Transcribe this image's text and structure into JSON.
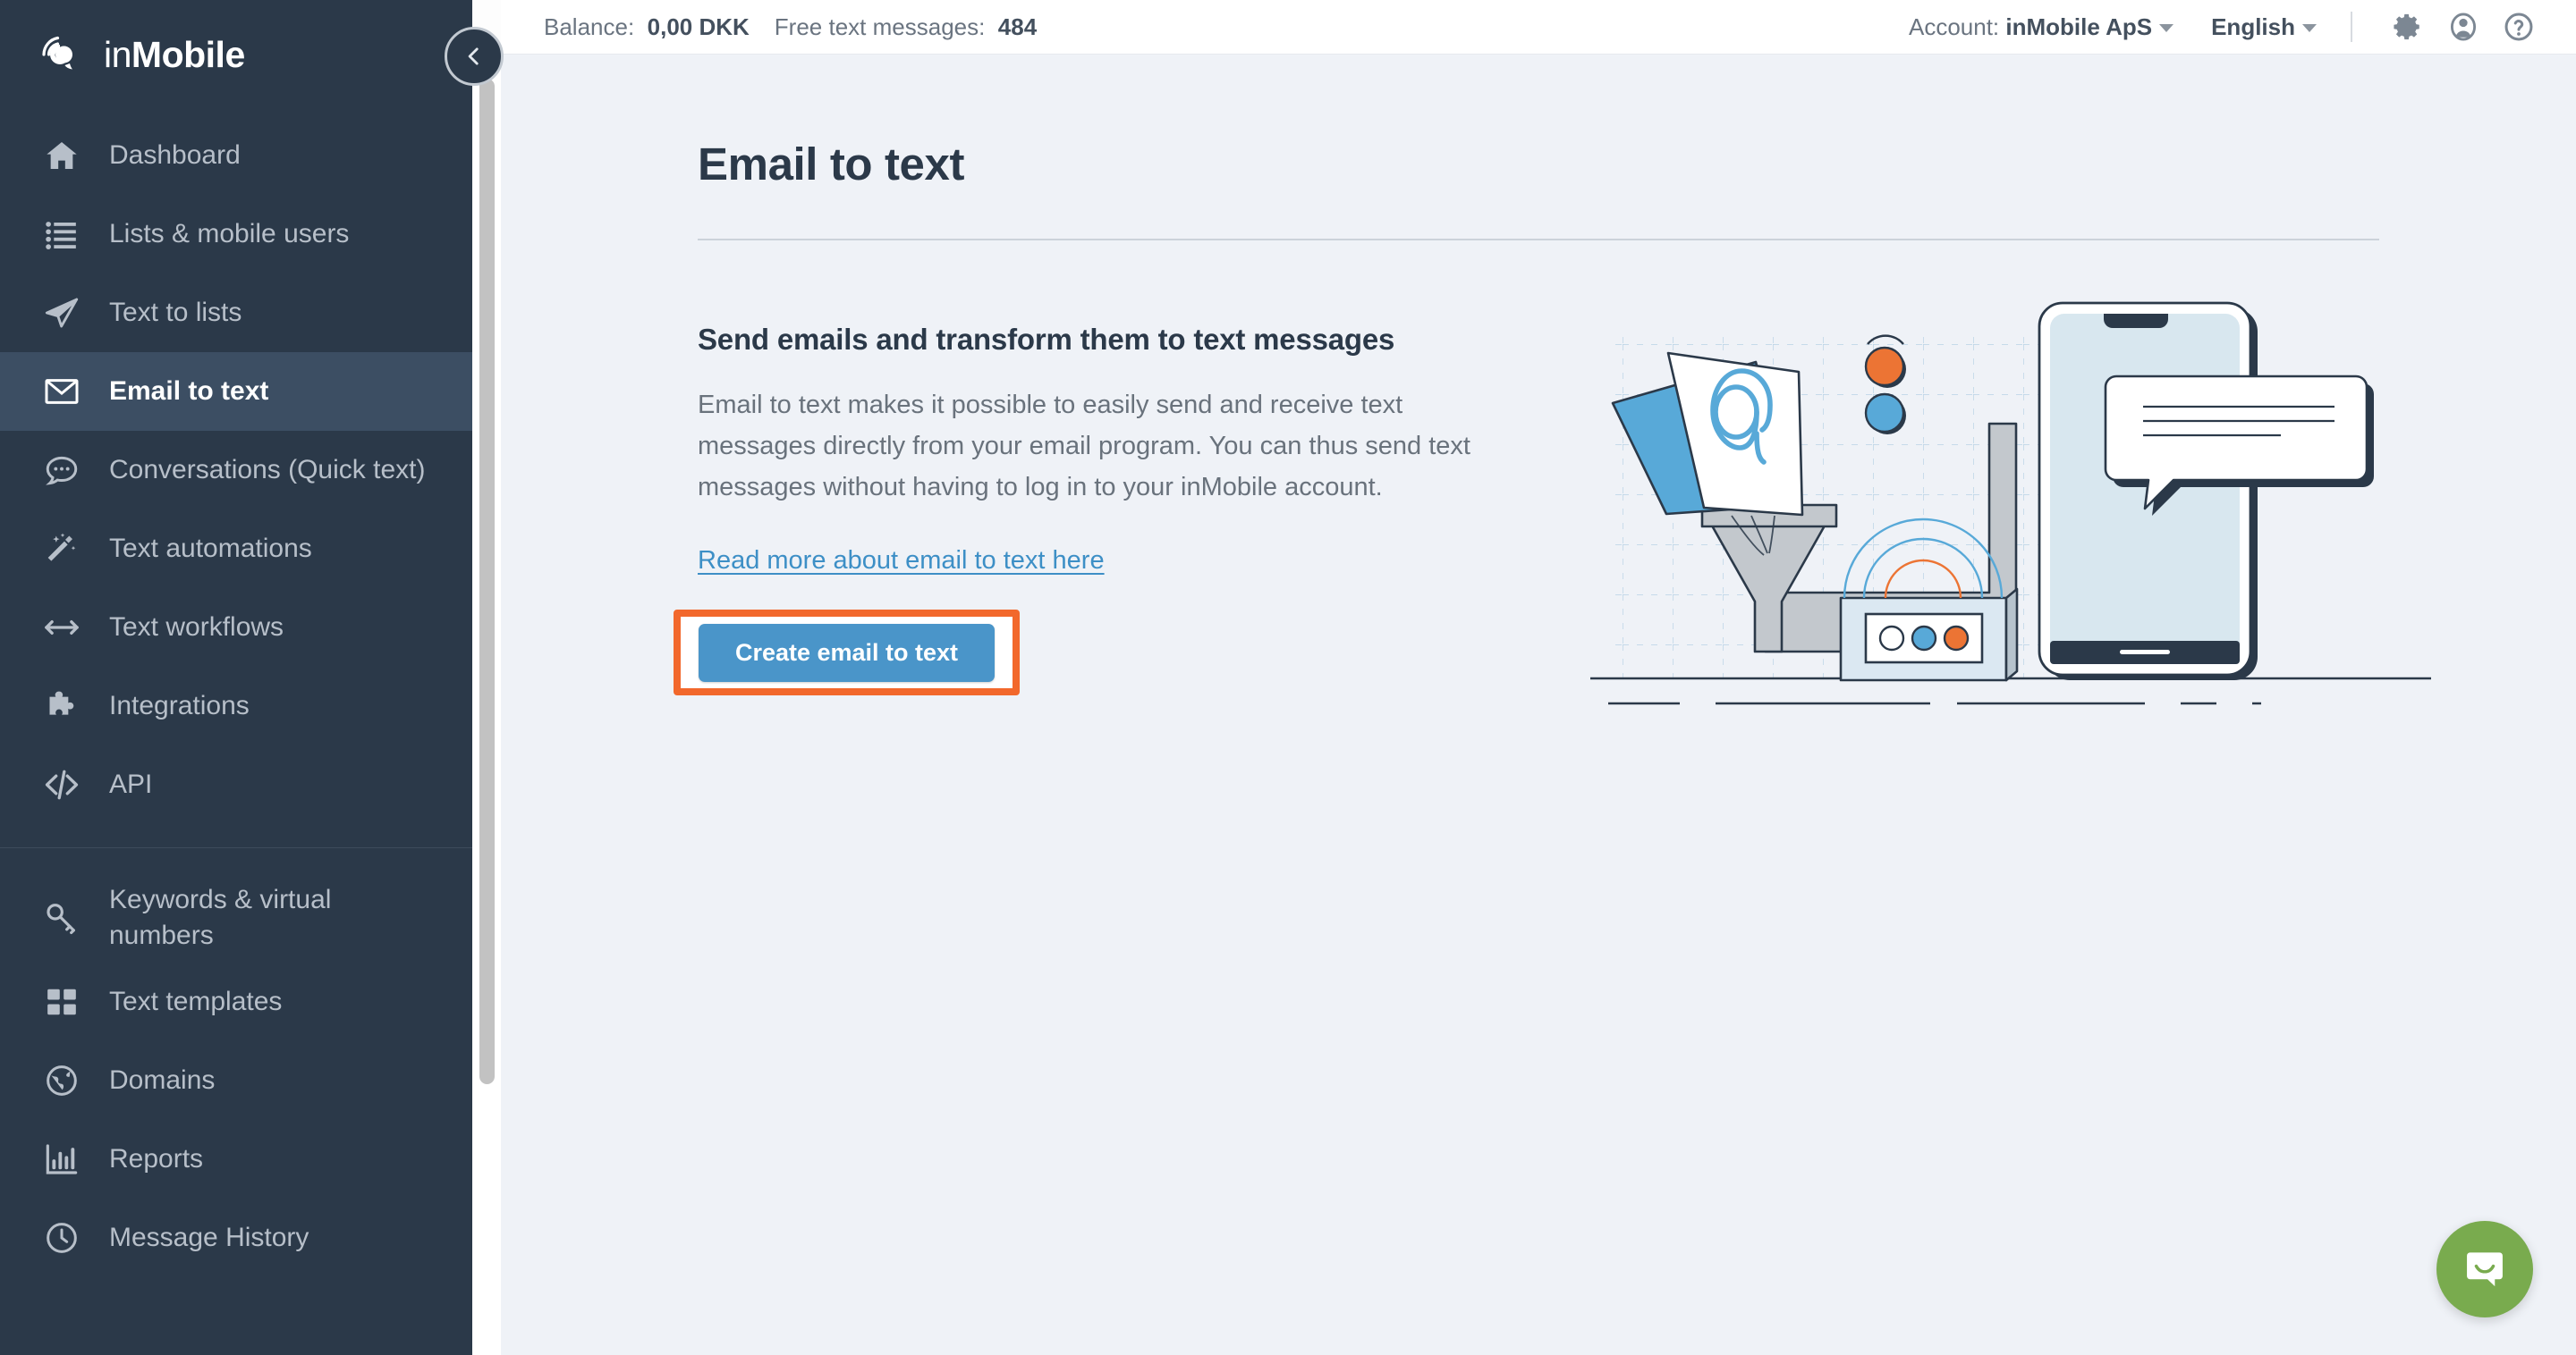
{
  "brand": {
    "name_light": "in",
    "name_bold": "Mobile",
    "logo_icon": "inmobile-logo-icon"
  },
  "topbar": {
    "balance_label": "Balance:",
    "balance_value": "0,00 DKK",
    "free_label": "Free text messages:",
    "free_value": "484",
    "account_label": "Account:",
    "account_value": "inMobile ApS",
    "language": "English",
    "icons": [
      "gear-icon",
      "user-icon",
      "help-icon"
    ]
  },
  "collapse_button": {
    "icon": "chevron-left-icon"
  },
  "sidebar": {
    "items": [
      {
        "label": "Dashboard",
        "icon": "home-icon",
        "active": false
      },
      {
        "label": "Lists & mobile users",
        "icon": "list-icon",
        "active": false
      },
      {
        "label": "Text to lists",
        "icon": "paper-plane-icon",
        "active": false
      },
      {
        "label": "Email to text",
        "icon": "envelope-icon",
        "active": true
      },
      {
        "label": "Conversations (Quick text)",
        "icon": "chat-bubble-icon",
        "active": false
      },
      {
        "label": "Text automations",
        "icon": "magic-wand-icon",
        "active": false
      },
      {
        "label": "Text workflows",
        "icon": "arrows-horizontal-icon",
        "active": false
      },
      {
        "label": "Integrations",
        "icon": "puzzle-piece-icon",
        "active": false
      },
      {
        "label": "API",
        "icon": "code-icon",
        "active": false
      }
    ],
    "items_secondary": [
      {
        "label": "Keywords & virtual numbers",
        "icon": "key-icon",
        "active": false
      },
      {
        "label": "Text templates",
        "icon": "grid-icon",
        "active": false
      },
      {
        "label": "Domains",
        "icon": "globe-icon",
        "active": false
      },
      {
        "label": "Reports",
        "icon": "bar-chart-icon",
        "active": false
      },
      {
        "label": "Message History",
        "icon": "clock-icon",
        "active": false
      }
    ]
  },
  "main": {
    "page_title": "Email to text",
    "section_heading": "Send emails and transform them to text messages",
    "body_text": "Email to text makes it possible to easily send and receive text messages directly from your email program. You can thus send text messages without having to log in to your inMobile account.",
    "read_more_link": "Read more about email to text here",
    "create_button": "Create email to text",
    "illustration_name": "email-to-text-illustration"
  },
  "chat_widget": {
    "icon": "chat-smile-icon"
  },
  "colors": {
    "sidebar_bg": "#2b3949",
    "sidebar_active_bg": "#3c4e63",
    "content_bg": "#eff2f7",
    "accent_blue": "#4a95c9",
    "link_blue": "#3d8fc6",
    "highlight_orange": "#f2682c",
    "chat_green": "#79ab4e"
  }
}
